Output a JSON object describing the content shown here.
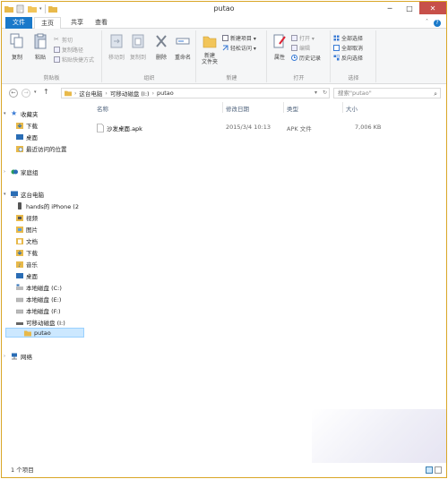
{
  "window": {
    "title": "putao",
    "controls": {
      "minimize": "─",
      "maximize": "□",
      "close": "✕"
    }
  },
  "tabs": {
    "file": "文件",
    "home": "主页",
    "share": "共享",
    "view": "查看"
  },
  "ribbon": {
    "clipboard": {
      "label": "剪贴板",
      "copy": "复制",
      "paste": "粘贴",
      "cut": "剪切",
      "copy_path": "复制路径",
      "paste_shortcut": "粘贴快捷方式"
    },
    "organize": {
      "label": "组织",
      "move_to": "移动到",
      "copy_to": "复制到",
      "delete": "删除",
      "rename": "重命名"
    },
    "new": {
      "label": "新建",
      "new_folder": "新建\n文件夹",
      "new_item": "新建项目 ▾",
      "easy_access": "轻松访问 ▾"
    },
    "open": {
      "label": "打开",
      "properties": "属性",
      "open": "打开 ▾",
      "edit": "编辑",
      "history": "历史记录"
    },
    "select": {
      "label": "选择",
      "select_all": "全部选择",
      "select_none": "全部取消",
      "invert": "反向选择"
    }
  },
  "address": {
    "path": [
      "这台电脑",
      "可移动磁盘 (I:)",
      "putao"
    ],
    "search_placeholder": "搜索\"putao\""
  },
  "nav": {
    "favorites": "收藏夹",
    "downloads": "下载",
    "desktop": "桌面",
    "recent": "最近访问的位置",
    "homegroup": "家庭组",
    "this_pc": "这台电脑",
    "iphone": "hands的 iPhone (2",
    "videos": "视频",
    "pictures": "图片",
    "documents": "文档",
    "downloads2": "下载",
    "music": "音乐",
    "desktop2": "桌面",
    "disk_c": "本地磁盘 (C:)",
    "disk_e": "本地磁盘 (E:)",
    "disk_f": "本地磁盘 (F:)",
    "disk_i": "可移动磁盘 (I:)",
    "putao": "putao",
    "network": "网络"
  },
  "columns": {
    "name": "名称",
    "modified": "修改日期",
    "type": "类型",
    "size": "大小"
  },
  "files": [
    {
      "name": "沙发桌面.apk",
      "modified": "2015/3/4 10:13",
      "type": "APK 文件",
      "size": "7,006 KB"
    }
  ],
  "status": {
    "count": "1 个项目"
  },
  "colors": {
    "accent": "#1979ca",
    "frame": "#d9a626",
    "close": "#c7504a",
    "selection": "#cce8ff"
  }
}
